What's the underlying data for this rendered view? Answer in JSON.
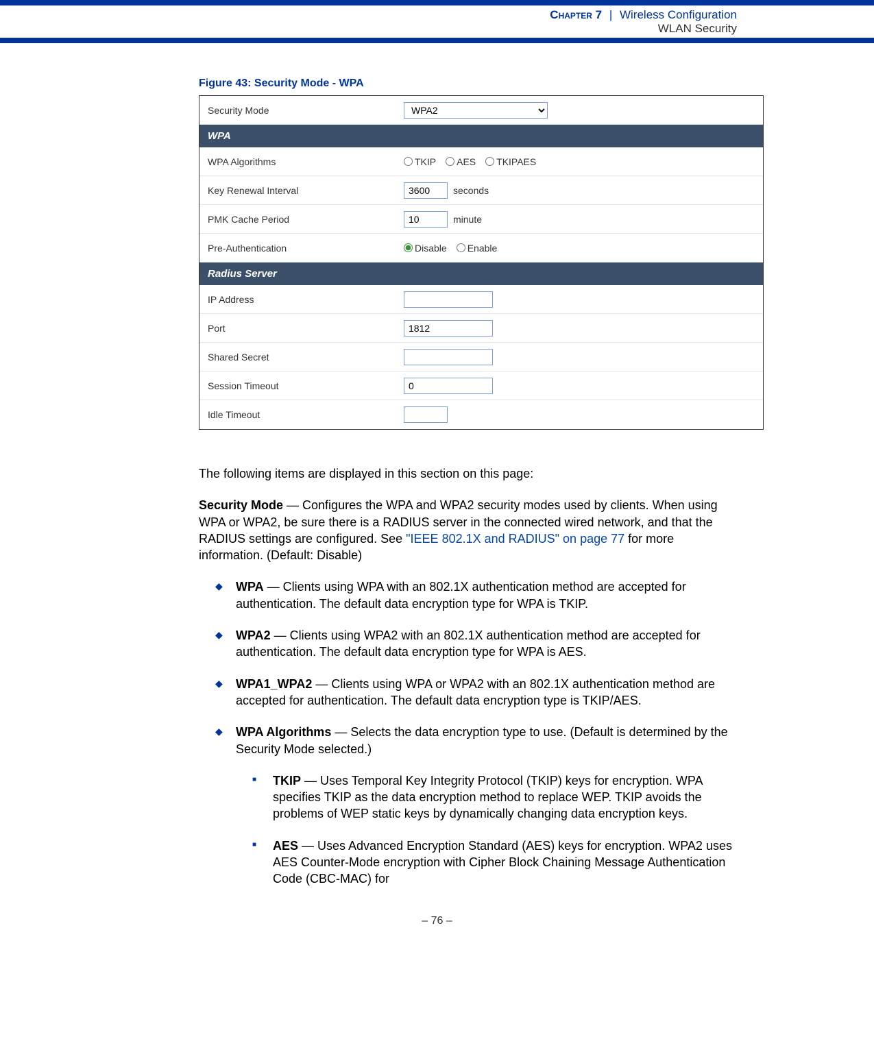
{
  "header": {
    "chapter_label": "Chapter 7",
    "separator": "|",
    "title": "Wireless Configuration",
    "subtitle": "WLAN Security"
  },
  "figure": {
    "caption": "Figure 43:  Security Mode - WPA",
    "rows": {
      "security_mode": {
        "label": "Security Mode",
        "value": "WPA2"
      },
      "wpa_section": "WPA",
      "wpa_algorithms": {
        "label": "WPA Algorithms",
        "options": {
          "tkip": "TKIP",
          "aes": "AES",
          "tkipaes": "TKIPAES"
        }
      },
      "key_renewal": {
        "label": "Key Renewal Interval",
        "value": "3600",
        "unit": "seconds"
      },
      "pmk_cache": {
        "label": "PMK Cache Period",
        "value": "10",
        "unit": "minute"
      },
      "pre_auth": {
        "label": "Pre-Authentication",
        "disable": "Disable",
        "enable": "Enable"
      },
      "radius_section": "Radius Server",
      "ip_address": {
        "label": "IP Address",
        "value": ""
      },
      "port": {
        "label": "Port",
        "value": "1812"
      },
      "shared_secret": {
        "label": "Shared Secret",
        "value": ""
      },
      "session_timeout": {
        "label": "Session Timeout",
        "value": "0"
      },
      "idle_timeout": {
        "label": "Idle Timeout",
        "value": ""
      }
    }
  },
  "body": {
    "intro": "The following items are displayed in this section on this page:",
    "security_mode_label": "Security Mode",
    "security_mode_text": " — Configures the WPA and WPA2 security modes used by clients. When using WPA or WPA2, be sure there is a RADIUS server in the connected wired network, and that the RADIUS settings are configured. See ",
    "link_text": "\"IEEE 802.1X and RADIUS\" on page 77",
    "security_mode_end": " for more information. (Default: Disable)",
    "items": [
      {
        "label": "WPA",
        "text": " — Clients using WPA with an 802.1X authentication method are accepted for authentication. The default data encryption type for WPA is TKIP."
      },
      {
        "label": "WPA2",
        "text": " — Clients using WPA2 with an 802.1X authentication method are accepted for authentication. The default data encryption type for WPA is AES."
      },
      {
        "label": "WPA1_WPA2",
        "text": " — Clients using WPA or WPA2 with an 802.1X authentication method are accepted for authentication. The default data encryption type is TKIP/AES."
      },
      {
        "label": "WPA Algorithms",
        "text": " — Selects the data encryption type to use. (Default is determined by the Security Mode selected.)"
      }
    ],
    "subitems": [
      {
        "label": "TKIP",
        "text": " — Uses Temporal Key Integrity Protocol (TKIP) keys for encryption. WPA specifies TKIP as the data encryption method to replace WEP. TKIP avoids the problems of WEP static keys by dynamically changing data encryption keys."
      },
      {
        "label": "AES",
        "text": " — Uses Advanced Encryption Standard (AES) keys for encryption. WPA2 uses AES Counter-Mode encryption with Cipher Block Chaining Message Authentication Code (CBC-MAC) for"
      }
    ]
  },
  "footer": {
    "page": "–  76  –"
  }
}
